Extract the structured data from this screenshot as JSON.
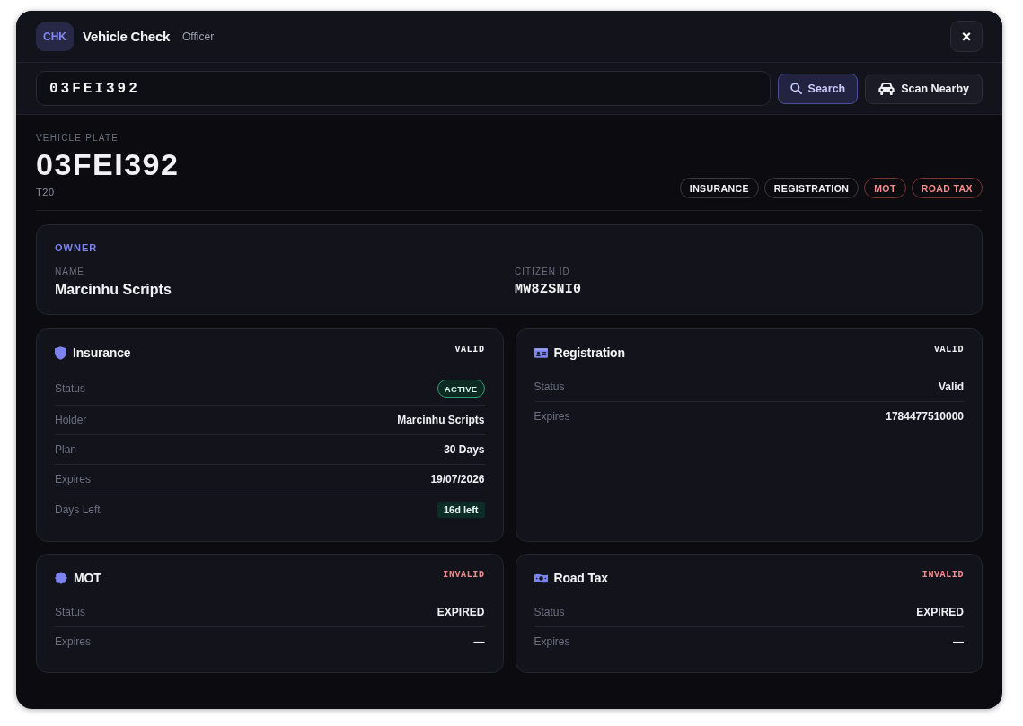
{
  "header": {
    "badge": "CHK",
    "title": "Vehicle Check",
    "role": "Officer",
    "close": "×"
  },
  "search": {
    "value": "03FEI392",
    "buttons": [
      {
        "label": "Search",
        "kind": "primary"
      },
      {
        "label": "Scan Nearby",
        "kind": "secondary"
      }
    ]
  },
  "vehicle": {
    "label": "VEHICLE PLATE",
    "plate": "03FEI392",
    "model": "T20",
    "chips": [
      {
        "label": "INSURANCE",
        "valid": true
      },
      {
        "label": "REGISTRATION",
        "valid": true
      },
      {
        "label": "MOT",
        "valid": false
      },
      {
        "label": "ROAD TAX",
        "valid": false
      }
    ]
  },
  "owner": {
    "title": "OWNER",
    "fields": [
      {
        "label": "NAME",
        "value": "Marcinhu Scripts",
        "kind": "text"
      },
      {
        "label": "CITIZEN ID",
        "value": "MW8ZSNI0",
        "kind": "code"
      }
    ]
  },
  "cards": [
    {
      "title": "Insurance",
      "status": "VALID",
      "valid": true,
      "rows": [
        {
          "label": "Status",
          "value": "ACTIVE",
          "kind": "pill"
        },
        {
          "label": "Holder",
          "value": "Marcinhu Scripts",
          "kind": "text"
        },
        {
          "label": "Plan",
          "value": "30 Days",
          "kind": "text"
        },
        {
          "label": "Expires",
          "value": "19/07/2026",
          "kind": "text"
        },
        {
          "label": "Days Left",
          "value": "16d left",
          "kind": "tag"
        }
      ]
    },
    {
      "title": "Registration",
      "status": "VALID",
      "valid": true,
      "rows": [
        {
          "label": "Status",
          "value": "Valid",
          "kind": "text"
        },
        {
          "label": "Expires",
          "value": "1784477510000",
          "kind": "text"
        }
      ]
    },
    {
      "title": "MOT",
      "status": "INVALID",
      "valid": false,
      "rows": [
        {
          "label": "Status",
          "value": "EXPIRED",
          "kind": "text"
        },
        {
          "label": "Expires",
          "value": "—",
          "kind": "text"
        }
      ]
    },
    {
      "title": "Road Tax",
      "status": "INVALID",
      "valid": false,
      "rows": [
        {
          "label": "Status",
          "value": "EXPIRED",
          "kind": "text"
        },
        {
          "label": "Expires",
          "value": "—",
          "kind": "text"
        }
      ]
    }
  ]
}
